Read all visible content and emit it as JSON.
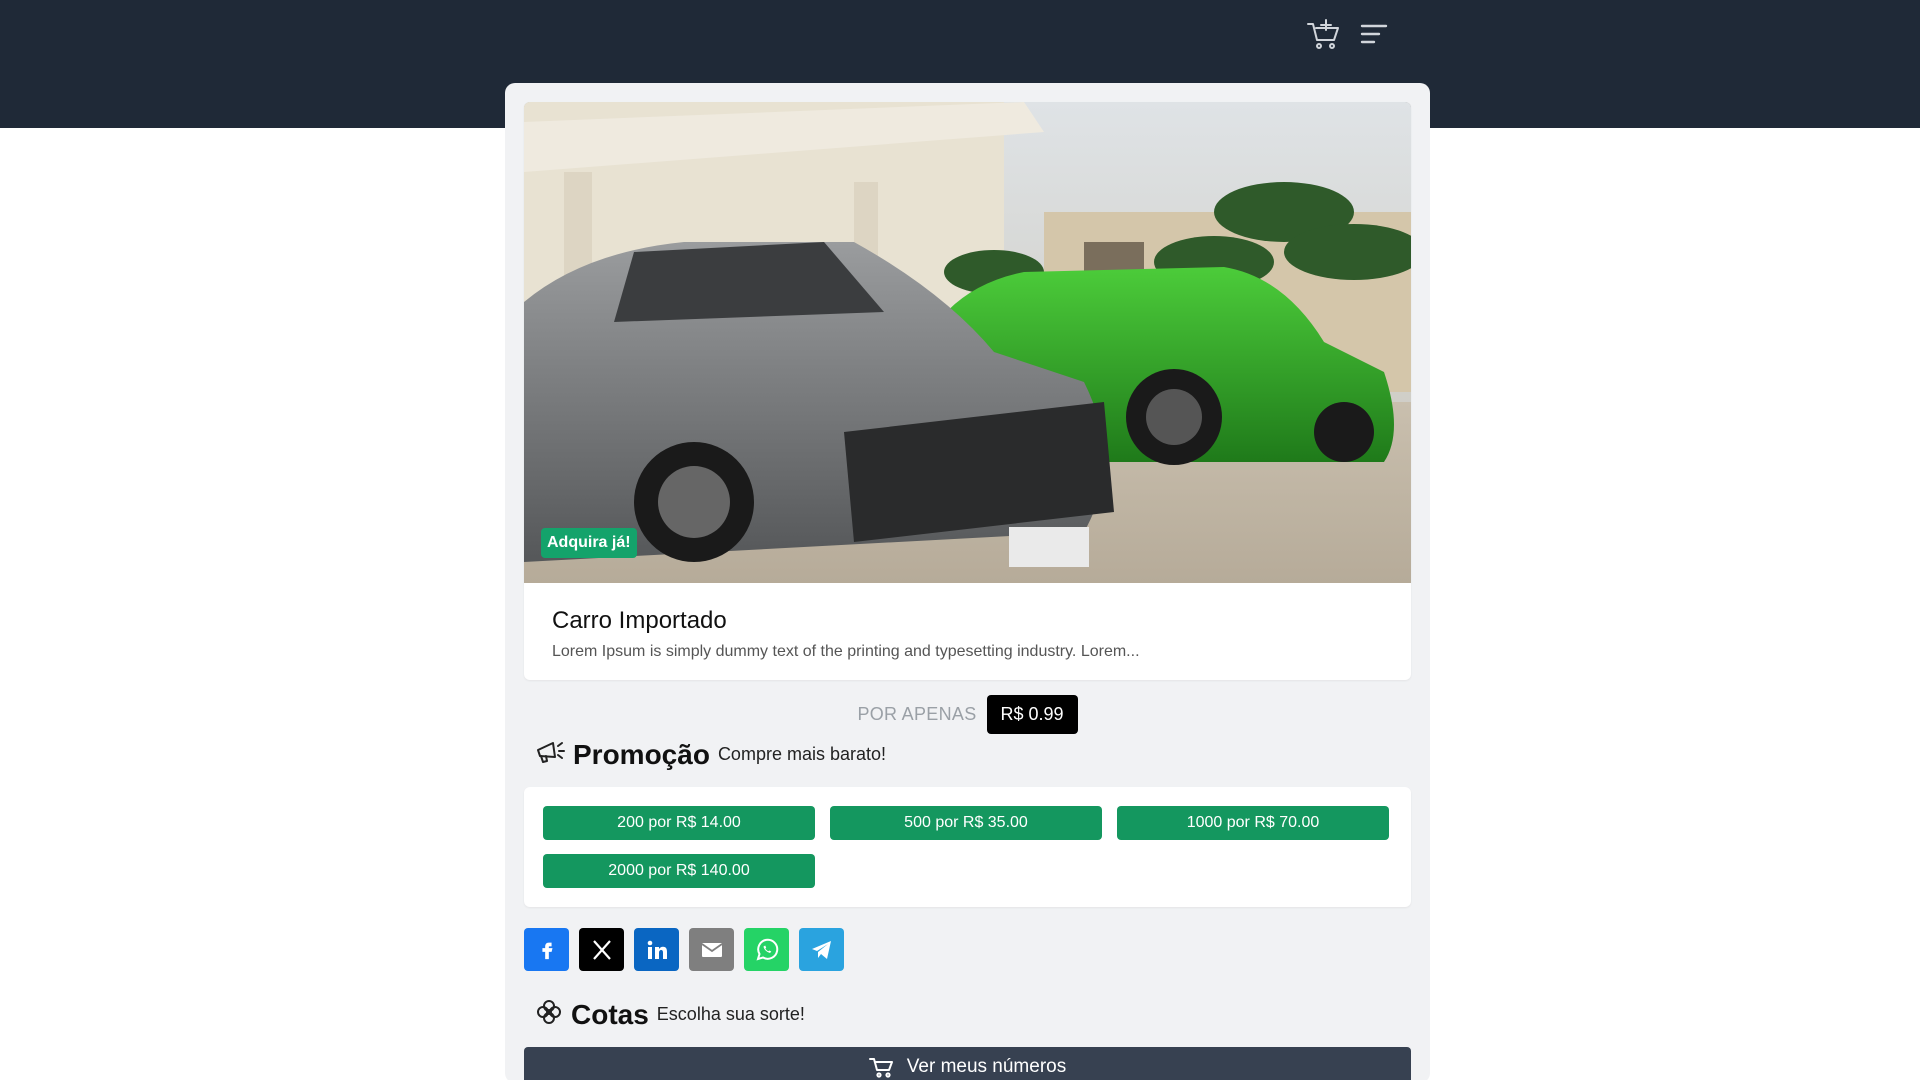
{
  "header": {
    "icons": [
      "cart-plus-icon",
      "menu-icon"
    ],
    "background": "#1f2937"
  },
  "product": {
    "badge": "Adquira já!",
    "title": "Carro Importado",
    "description": "Lorem Ipsum is simply dummy text of the printing and typesetting industry. Lorem..."
  },
  "price": {
    "label": "POR APENAS",
    "value": "R$ 0.99"
  },
  "promo": {
    "title": "Promoção",
    "subtitle": "Compre mais barato!",
    "icon": "megaphone-icon",
    "buttons": [
      "200 por R$ 14.00",
      "500 por R$ 35.00",
      "1000 por R$ 70.00",
      "2000 por R$ 140.00"
    ],
    "button_color": "#14975f"
  },
  "share": {
    "buttons": [
      {
        "name": "facebook",
        "color": "#1877f2"
      },
      {
        "name": "x",
        "color": "#000000"
      },
      {
        "name": "linkedin",
        "color": "#0a66c2"
      },
      {
        "name": "email",
        "color": "#7f7f7f"
      },
      {
        "name": "whatsapp",
        "color": "#25d366"
      },
      {
        "name": "telegram",
        "color": "#2aa3df"
      }
    ]
  },
  "quotas": {
    "title": "Cotas",
    "subtitle": "Escolha sua sorte!",
    "icon": "clover-icon",
    "my_numbers_label": "Ver meus números"
  }
}
